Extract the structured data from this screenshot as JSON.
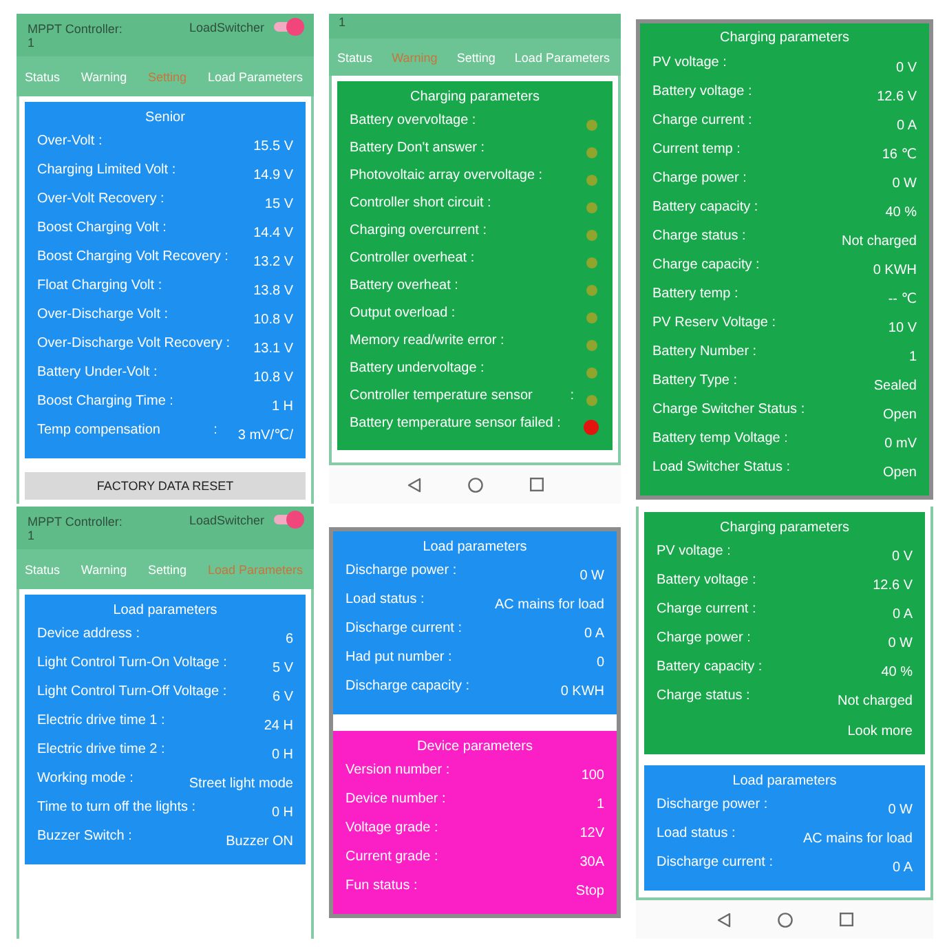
{
  "screens": [
    {
      "kind": "phone",
      "header": {
        "title": "MPPT Controller:",
        "number": "1",
        "switch_label": "LoadSwitcher",
        "switch_on": true
      },
      "tabs": [
        {
          "label": "Status",
          "selected": false
        },
        {
          "label": "Warning",
          "selected": false
        },
        {
          "label": "Setting",
          "selected": true
        },
        {
          "label": "Load Parameters",
          "selected": false
        }
      ],
      "cards": [
        {
          "kind": "values",
          "title": "Senior",
          "color": "#1e90f0",
          "rows": [
            {
              "label": "Over-Volt :",
              "value": "15.5 V"
            },
            {
              "label": "Charging Limited Volt :",
              "value": "14.9 V"
            },
            {
              "label": "Over-Volt Recovery :",
              "value": "15 V"
            },
            {
              "label": "Boost Charging Volt :",
              "value": "14.4 V"
            },
            {
              "label": "Boost Charging Volt Recovery :",
              "value": "13.2 V"
            },
            {
              "label": "Float Charging Volt :",
              "value": "13.8 V"
            },
            {
              "label": "Over-Discharge Volt :",
              "value": "10.8 V"
            },
            {
              "label": "Over-Discharge Volt Recovery :",
              "value": "13.1 V"
            },
            {
              "label": "Battery Under-Volt :",
              "value": "10.8 V"
            },
            {
              "label": "Boost Charging Time :",
              "value": "1 H"
            },
            {
              "label": "Temp compensation",
              "colon": ":",
              "value": "3 mV/℃/"
            }
          ]
        }
      ],
      "button": "FACTORY DATA RESET"
    },
    {
      "kind": "phone",
      "header": {
        "number": "1"
      },
      "tabs": [
        {
          "label": "Status",
          "selected": false
        },
        {
          "label": "Warning",
          "selected": true
        },
        {
          "label": "Setting",
          "selected": false
        },
        {
          "label": "Load Parameters",
          "selected": false
        }
      ],
      "cards": [
        {
          "kind": "alarms",
          "title": "Charging parameters",
          "color": "#19a74b",
          "rows": [
            {
              "label": "Battery overvoltage :",
              "active": false
            },
            {
              "label": "Battery Don't answer :",
              "active": false
            },
            {
              "label": "Photovoltaic array overvoltage :",
              "active": false
            },
            {
              "label": "Controller short circuit :",
              "active": false
            },
            {
              "label": "Charging overcurrent :",
              "active": false
            },
            {
              "label": "Controller overheat :",
              "active": false
            },
            {
              "label": "Battery overheat :",
              "active": false
            },
            {
              "label": "Output overload :",
              "active": false
            },
            {
              "label": "Memory read/write error :",
              "active": false
            },
            {
              "label": "Battery undervoltage :",
              "active": false
            },
            {
              "label": "Controller temperature sensor",
              "colon": ":",
              "active": false
            },
            {
              "label": "Battery temperature sensor failed :",
              "active": true
            }
          ]
        }
      ],
      "nav_bar": true
    },
    {
      "kind": "crop",
      "cards": [
        {
          "kind": "values",
          "title": "Charging parameters",
          "color": "#19a74b",
          "rows": [
            {
              "label": "PV voltage :",
              "value": "0 V"
            },
            {
              "label": "Battery voltage :",
              "value": "12.6 V"
            },
            {
              "label": "Charge current :",
              "value": "0 A"
            },
            {
              "label": "Current temp :",
              "value": "16 ℃"
            },
            {
              "label": "Charge power :",
              "value": "0 W"
            },
            {
              "label": "Battery capacity :",
              "value": "40 %"
            },
            {
              "label": "Charge status :",
              "value": "Not charged"
            },
            {
              "label": "Charge capacity :",
              "value": "0 KWH"
            },
            {
              "label": "Battery temp :",
              "value": "-- ℃"
            },
            {
              "label": "PV Reserv Voltage :",
              "value": "10 V"
            },
            {
              "label": "Battery Number :",
              "value": "1"
            },
            {
              "label": "Battery Type :",
              "value": "Sealed"
            },
            {
              "label": "Charge Switcher Status :",
              "value": "Open"
            },
            {
              "label": "Battery temp Voltage :",
              "value": "0 mV"
            },
            {
              "label": "Load Switcher Status :",
              "value": "Open"
            }
          ]
        }
      ]
    },
    {
      "kind": "phone",
      "header": {
        "title": "MPPT Controller:",
        "number": "1",
        "switch_label": "LoadSwitcher",
        "switch_on": true
      },
      "tabs": [
        {
          "label": "Status",
          "selected": false
        },
        {
          "label": "Warning",
          "selected": false
        },
        {
          "label": "Setting",
          "selected": false
        },
        {
          "label": "Load Parameters",
          "selected": true
        }
      ],
      "cards": [
        {
          "kind": "values",
          "title": "Load parameters",
          "color": "#1e90f0",
          "rows": [
            {
              "label": "Device address :",
              "value": "6"
            },
            {
              "label": "Light Control Turn-On Voltage :",
              "value": "5 V"
            },
            {
              "label": "Light Control Turn-Off Voltage :",
              "value": "6 V"
            },
            {
              "label": "Electric drive time 1 :",
              "value": "24 H"
            },
            {
              "label": "Electric drive time 2 :",
              "value": "0 H"
            },
            {
              "label": "Working mode :",
              "value": "Street light mode"
            },
            {
              "label": "Time to turn off the lights :",
              "value": "0 H"
            },
            {
              "label": "Buzzer Switch :",
              "value": "Buzzer ON"
            }
          ]
        }
      ]
    },
    {
      "kind": "crop",
      "cards": [
        {
          "kind": "values",
          "title": "Load parameters",
          "color": "#1e90f0",
          "rows": [
            {
              "label": "Discharge power :",
              "value": "0 W"
            },
            {
              "label": "Load status :",
              "value": "AC mains for load"
            },
            {
              "label": "Discharge current :",
              "value": "0 A"
            },
            {
              "label": "Had put number :",
              "value": "0"
            },
            {
              "label": "Discharge capacity :",
              "value": "0 KWH"
            }
          ]
        },
        {
          "kind": "values",
          "title": "Device parameters",
          "color": "#fb20c6",
          "rows": [
            {
              "label": "Version number :",
              "value": "100"
            },
            {
              "label": "Device number :",
              "value": "1"
            },
            {
              "label": "Voltage grade :",
              "value": "12V"
            },
            {
              "label": "Current grade :",
              "value": "30A"
            },
            {
              "label": "Fun status :",
              "value": "Stop"
            }
          ]
        }
      ]
    },
    {
      "kind": "phone",
      "cards": [
        {
          "kind": "values",
          "title": "Charging parameters",
          "color": "#19a74b",
          "rows": [
            {
              "label": "PV voltage :",
              "value": "0 V"
            },
            {
              "label": "Battery voltage :",
              "value": "12.6 V"
            },
            {
              "label": "Charge current :",
              "value": "0 A"
            },
            {
              "label": "Charge power :",
              "value": "0 W"
            },
            {
              "label": "Battery capacity :",
              "value": "40 %"
            },
            {
              "label": "Charge status :",
              "value": "Not charged"
            }
          ],
          "link": "Look more"
        },
        {
          "kind": "values",
          "title": "Load parameters",
          "color": "#1e90f0",
          "rows": [
            {
              "label": "Discharge power :",
              "value": "0 W"
            },
            {
              "label": "Load status :",
              "value": "AC mains for load"
            },
            {
              "label": "Discharge current :",
              "value": "0 A"
            }
          ]
        }
      ],
      "nav_bar": true
    }
  ]
}
